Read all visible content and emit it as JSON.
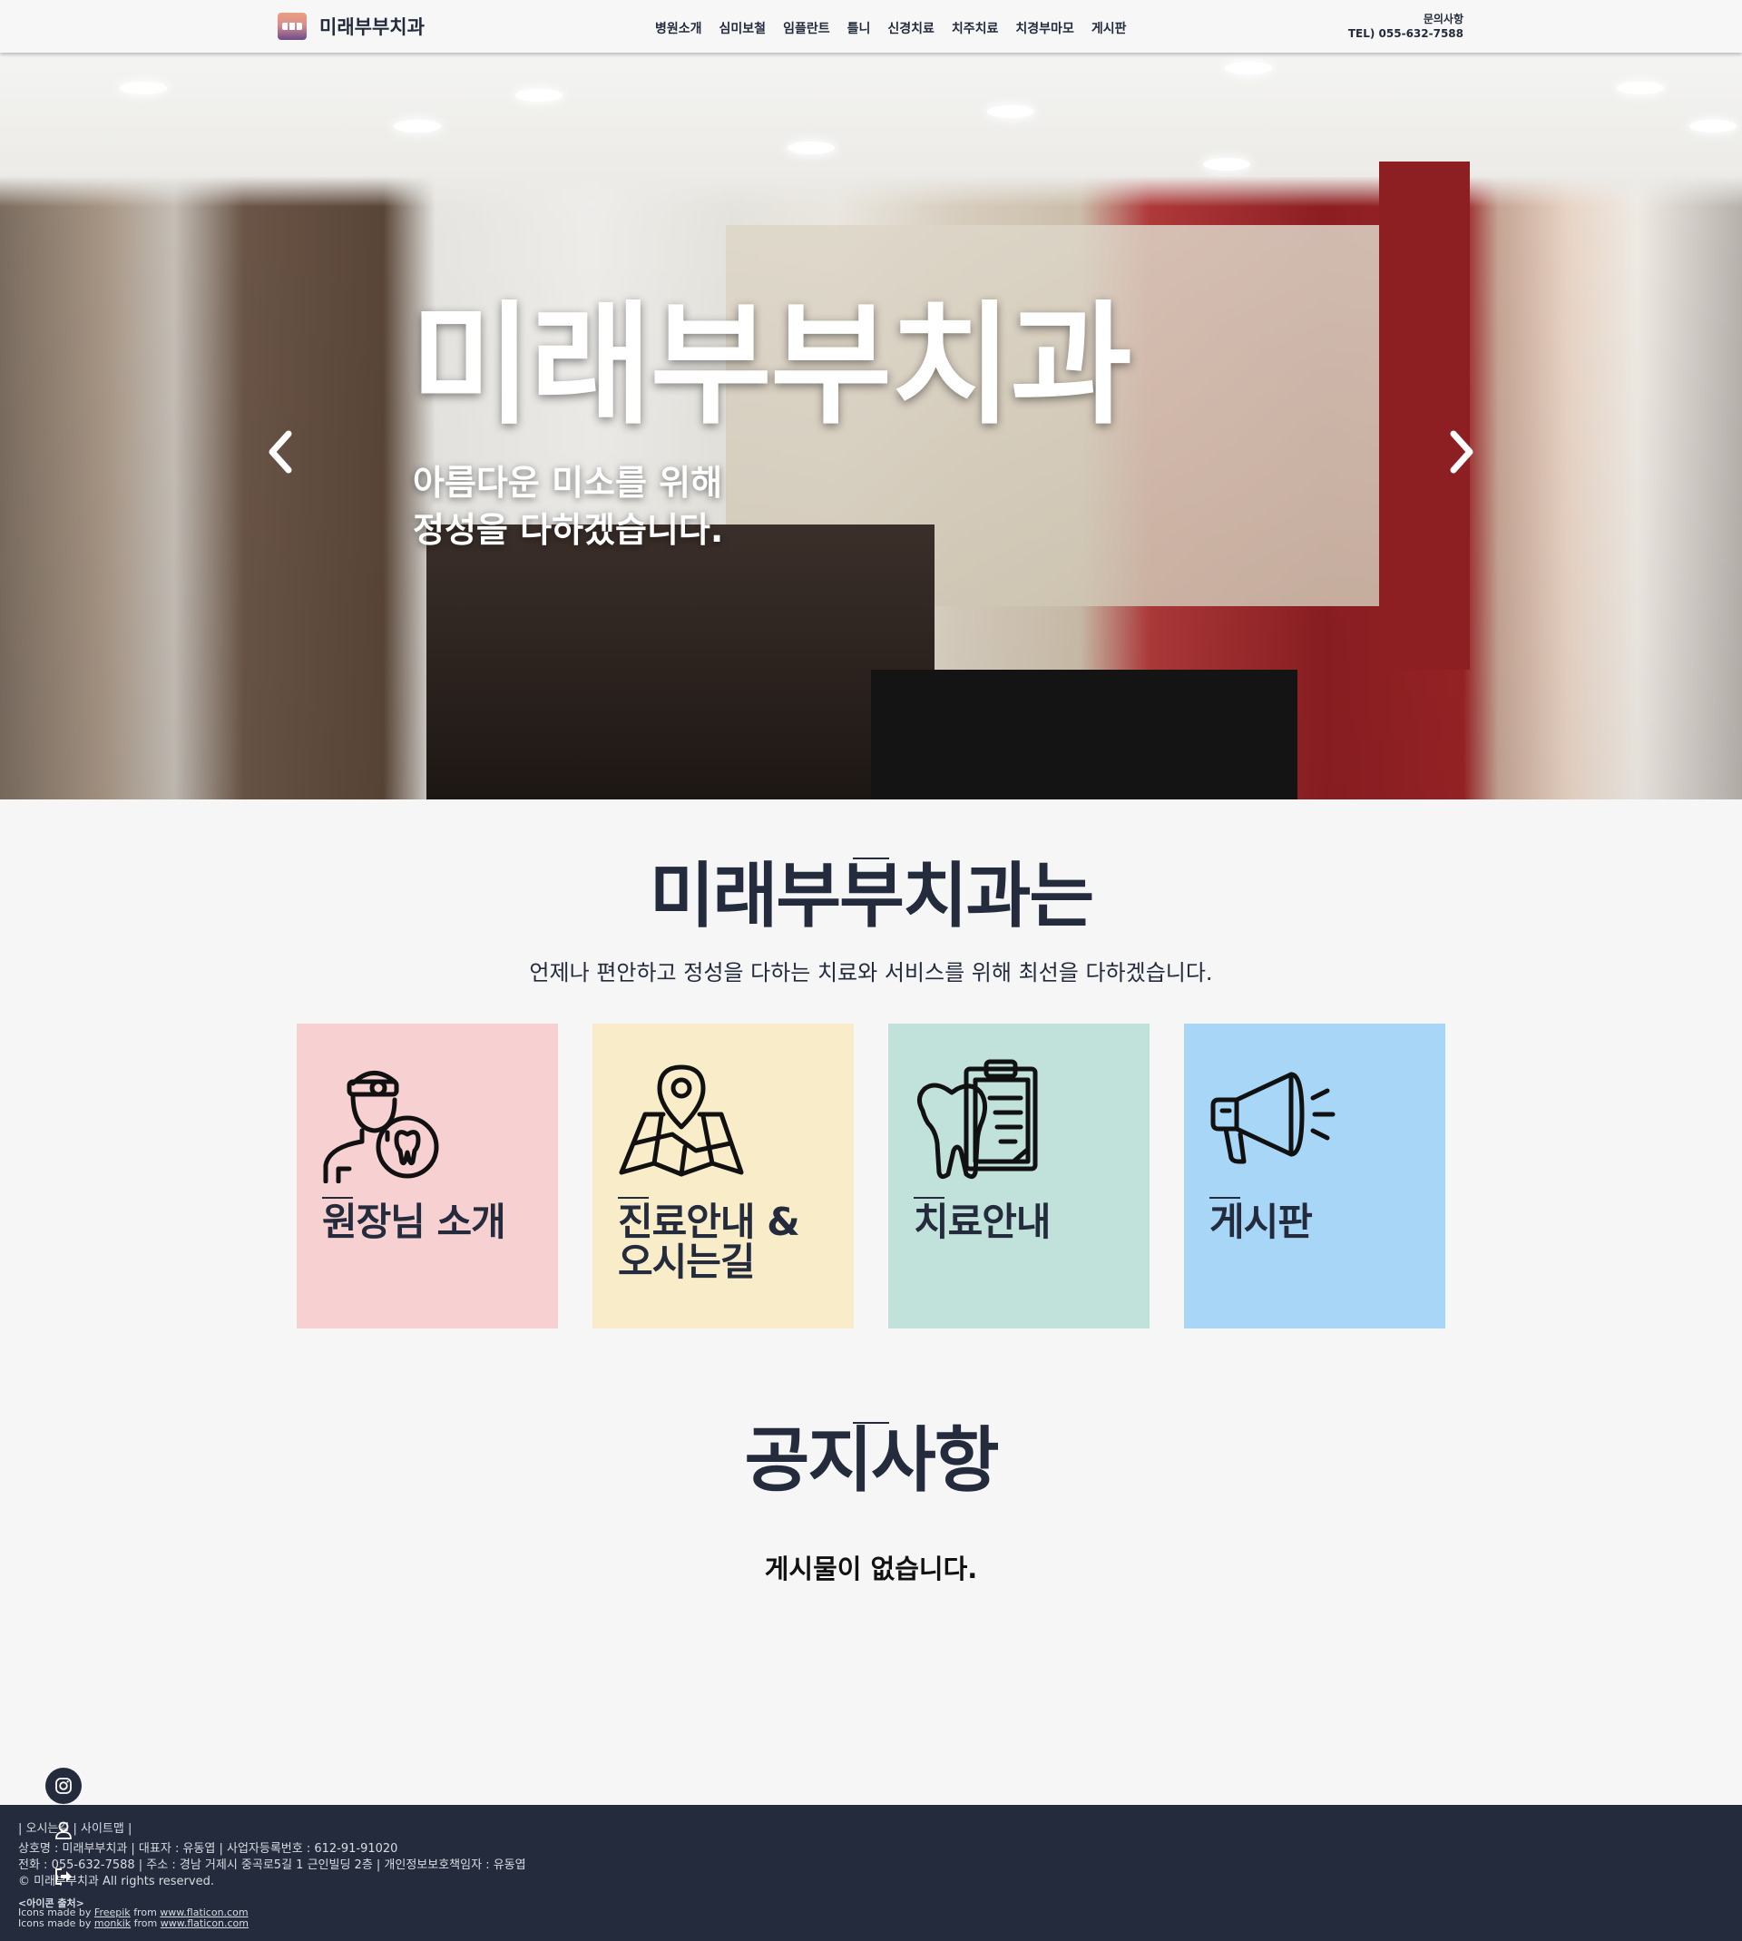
{
  "header": {
    "logo_text": "미래부부치과",
    "nav": [
      "병원소개",
      "심미보철",
      "임플란트",
      "틀니",
      "신경치료",
      "치주치료",
      "치경부마모",
      "게시판"
    ],
    "contact_label": "문의사항",
    "contact_tel": "TEL) 055-632-7588"
  },
  "hero": {
    "title": "미래부부치과",
    "subtitle_line1": "아름다운 미소를 위해",
    "subtitle_line2": "정성을 다하겠습니다.",
    "prev_icon": "chevron-left-icon",
    "next_icon": "chevron-right-icon"
  },
  "intro": {
    "title": "미래부부치과는",
    "description": "언제나 편안하고 정성을 다하는 치료와 서비스를 위해 최선을 다하겠습니다."
  },
  "cards": [
    {
      "title": "원장님 소개",
      "icon": "dentist-icon",
      "color": "#f7d0d1"
    },
    {
      "title": "진료안내 & 오시는길",
      "icon": "map-pin-icon",
      "color": "#f9edc9"
    },
    {
      "title": "치료안내",
      "icon": "tooth-clipboard-icon",
      "color": "#c1e2da"
    },
    {
      "title": "게시판",
      "icon": "megaphone-icon",
      "color": "#a7d6f6"
    }
  ],
  "notice": {
    "title": "공지사항",
    "empty_text": "게시물이 없습니다."
  },
  "footer": {
    "links_line": "| 오시는길 | 사이트맵 |",
    "company_line": "상호명 : 미래부부치과 | 대표자 : 유동엽 | 사업자등록번호 : 612-91-91020",
    "contact_line": "전화 : 055-632-7588 | 주소 : 경남 거제시 중곡로5길 1 근인빌딩 2층 | 개인정보보호책임자 : 유동엽",
    "copyright": "© 미래부부치과 All rights reserved.",
    "icon_source_label": "<아이콘 출처>",
    "credit1_prefix": "Icons made by",
    "credit1_author": "Freepik",
    "credit1_from": "from",
    "credit1_site": "www.flaticon.com",
    "credit2_prefix": "Icons made by",
    "credit2_author": "monkik",
    "credit2_from": "from",
    "credit2_site": "www.flaticon.com"
  },
  "floating": {
    "instagram_icon": "instagram-icon",
    "user_icon": "user-icon",
    "logout_icon": "logout-icon"
  },
  "colors": {
    "navy": "#232b3d",
    "footer_bg": "#242b3d",
    "page_bg": "#f6f6f6"
  }
}
